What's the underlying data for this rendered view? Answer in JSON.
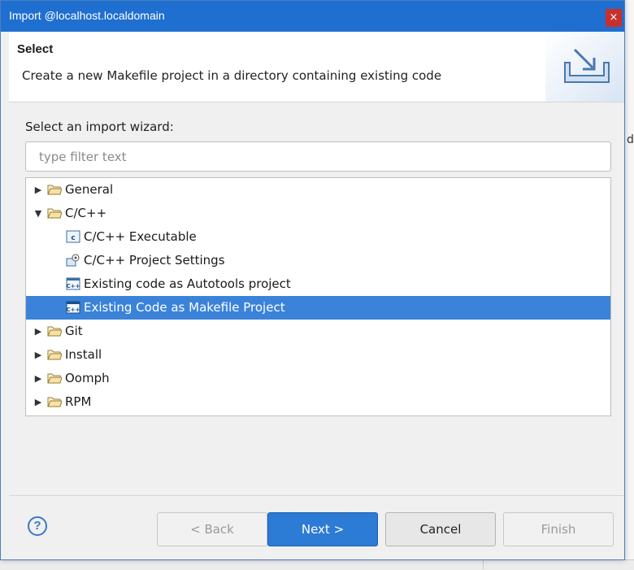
{
  "background": {
    "edge_text": "di"
  },
  "dialog": {
    "title": "Import @localhost.localdomain",
    "close_glyph": "×"
  },
  "header": {
    "title": "Select",
    "description": "Create a new Makefile project in a directory containing existing code",
    "banner_icon": "import-wizard-icon"
  },
  "wizard": {
    "label": "Select an import wizard:",
    "filter_placeholder": "type filter text",
    "filter_value": ""
  },
  "tree": {
    "items": [
      {
        "label": "General",
        "type": "folder",
        "expanded": false,
        "selected": false,
        "icon": "folder-icon"
      },
      {
        "label": "C/C++",
        "type": "folder",
        "expanded": true,
        "selected": false,
        "icon": "folder-icon"
      },
      {
        "label": "C/C++ Executable",
        "type": "leaf",
        "selected": false,
        "icon": "cpp-executable-icon"
      },
      {
        "label": "C/C++ Project Settings",
        "type": "leaf",
        "selected": false,
        "icon": "project-settings-icon"
      },
      {
        "label": "Existing code as Autotools project",
        "type": "leaf",
        "selected": false,
        "icon": "cpp-project-icon"
      },
      {
        "label": "Existing Code as Makefile Project",
        "type": "leaf",
        "selected": true,
        "icon": "cpp-project-icon"
      },
      {
        "label": "Git",
        "type": "folder",
        "expanded": false,
        "selected": false,
        "icon": "folder-icon"
      },
      {
        "label": "Install",
        "type": "folder",
        "expanded": false,
        "selected": false,
        "icon": "folder-icon"
      },
      {
        "label": "Oomph",
        "type": "folder",
        "expanded": false,
        "selected": false,
        "icon": "folder-icon"
      },
      {
        "label": "RPM",
        "type": "folder",
        "expanded": false,
        "selected": false,
        "icon": "folder-icon"
      }
    ]
  },
  "footer": {
    "help_glyph": "?",
    "back_label": "< Back",
    "next_label": "Next >",
    "cancel_label": "Cancel",
    "finish_label": "Finish"
  },
  "colors": {
    "titlebar": "#1f6fd0",
    "selection": "#3b83d9",
    "primary_button": "#2c7bd4",
    "close_button": "#c9302c"
  }
}
